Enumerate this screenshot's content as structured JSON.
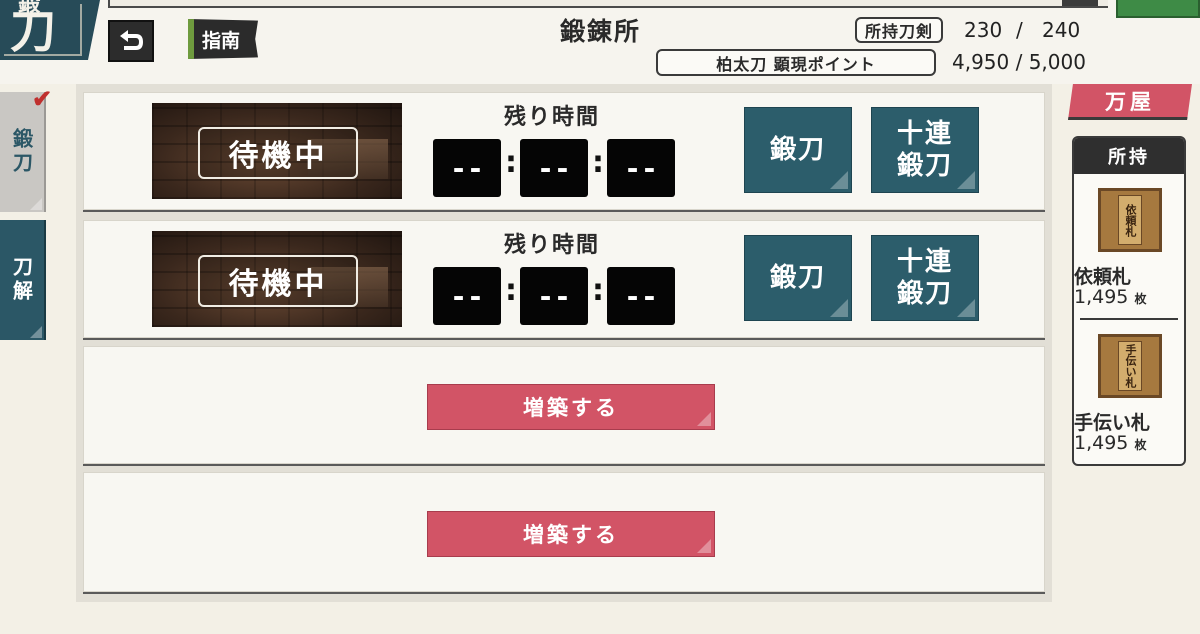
{
  "header": {
    "section_title": "刀",
    "section_title_top": "鍛",
    "guide_label": "指南",
    "page_title": "鍛錬所",
    "sword_count_label": "所持刀剣",
    "sword_count_value": "230",
    "sword_count_sep": "/",
    "sword_count_max": "240",
    "points_label": "柏太刀 顕現ポイント",
    "points_value": "4,950 / 5,000"
  },
  "side_tabs": [
    {
      "label": "鍛刀",
      "active": true
    },
    {
      "label": "刀解",
      "active": false
    }
  ],
  "slots": [
    {
      "status": "待機中",
      "remaining_label": "残り時間",
      "hours": "--",
      "minutes": "--",
      "seconds": "--",
      "forge_label": "鍛刀",
      "forge10_label": "十連\n鍛刀"
    },
    {
      "status": "待機中",
      "remaining_label": "残り時間",
      "hours": "--",
      "minutes": "--",
      "seconds": "--",
      "forge_label": "鍛刀",
      "forge10_label": "十連\n鍛刀"
    }
  ],
  "expand_slots": [
    {
      "label": "増築する"
    },
    {
      "label": "増築する"
    }
  ],
  "timer_separator": ":",
  "shop": {
    "label": "万屋"
  },
  "inventory": {
    "header": "所持",
    "items": [
      {
        "name": "依頼札",
        "count": "1,495",
        "unit": "枚",
        "icon_text": "依頼札"
      },
      {
        "name": "手伝い札",
        "count": "1,495",
        "unit": "枚",
        "icon_text": "手伝い札"
      }
    ]
  },
  "colors": {
    "teal": "#2c5d6b",
    "pink": "#d25466",
    "background": "#f3f0e6",
    "green": "#3e8b46"
  }
}
